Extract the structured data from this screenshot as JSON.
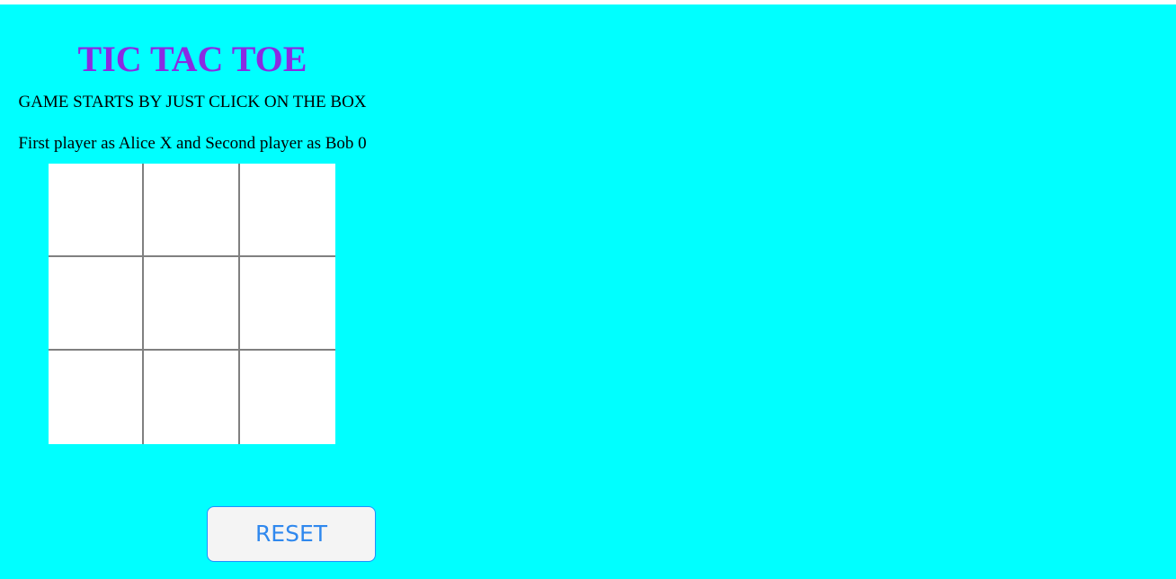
{
  "game": {
    "title": "TIC TAC TOE",
    "instruction": "GAME STARTS BY JUST CLICK ON THE BOX",
    "players_text": "First player as Alice X and Second player as Bob 0",
    "board": {
      "cells": [
        "",
        "",
        "",
        "",
        "",
        "",
        "",
        "",
        ""
      ]
    },
    "reset_label": "RESET"
  },
  "colors": {
    "background": "#00ffff",
    "title": "#8a2be2",
    "grid_lines": "#808080",
    "cell_fill": "#ffffff",
    "reset_text": "#2f88ee",
    "reset_border": "#1e90ff",
    "reset_fill": "#f4f4f4"
  }
}
